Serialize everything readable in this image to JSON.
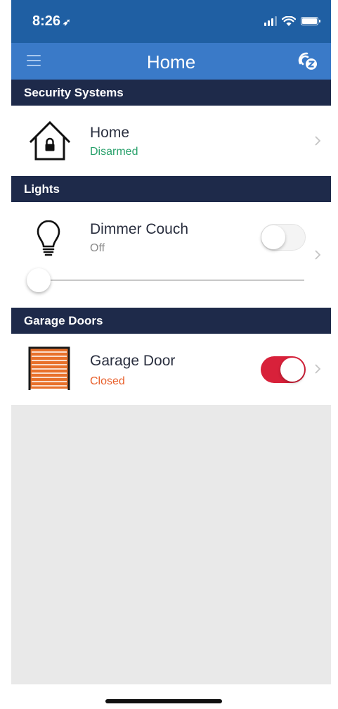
{
  "status_bar": {
    "time": "8:26",
    "location_glyph": "➶"
  },
  "nav": {
    "title": "Home",
    "menu_icon": "hamburger-icon",
    "right_icon": "zwave-icon"
  },
  "sections": [
    {
      "header": "Security Systems",
      "items": [
        {
          "name": "Home",
          "status": "Disarmed",
          "status_color": "#27a06a",
          "icon": "house-lock-icon"
        }
      ]
    },
    {
      "header": "Lights",
      "items": [
        {
          "name": "Dimmer Couch",
          "status": "Off",
          "status_color": "#8a8a8a",
          "icon": "lightbulb-icon",
          "toggle_on": false,
          "dimmer_level": 0
        }
      ]
    },
    {
      "header": "Garage Doors",
      "items": [
        {
          "name": "Garage Door",
          "status": "Closed",
          "status_color": "#e8602c",
          "icon": "garage-door-icon",
          "toggle_on": true
        }
      ]
    }
  ],
  "colors": {
    "status_bar": "#1f5fa3",
    "nav_bar": "#3a7ac8",
    "section_header": "#1e2a4a",
    "toggle_on": "#d8213a",
    "garage_orange": "#e8712b"
  }
}
